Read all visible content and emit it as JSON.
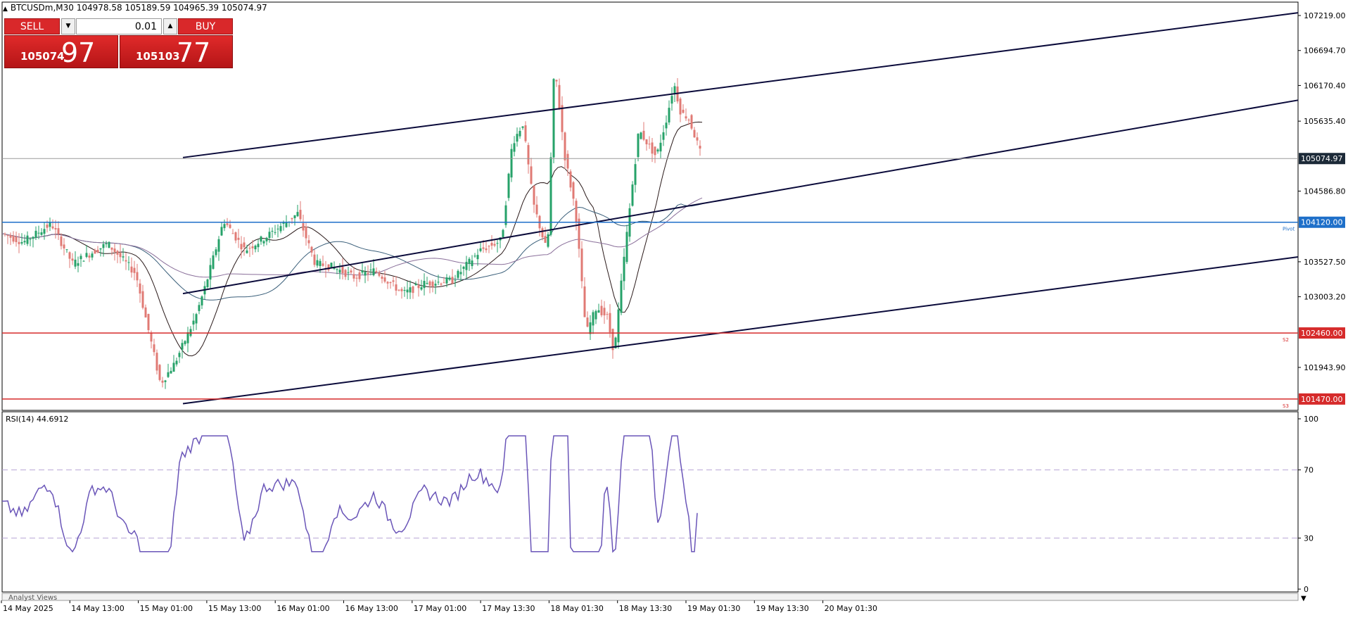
{
  "header": {
    "symbol_line": "BTCUSDm,M30  104978.58 105189.59 104965.39 105074.97"
  },
  "trade_panel": {
    "sell_label": "SELL",
    "buy_label": "BUY",
    "lot_value": "0.01",
    "sell_price_prefix": "105074",
    "sell_price_big": "97",
    "buy_price_prefix": "105103",
    "buy_price_big": "77"
  },
  "price_axis": {
    "ticks": [
      "107219.00",
      "106694.70",
      "106170.40",
      "105635.40",
      "104586.80",
      "103527.50",
      "103003.20",
      "101943.90"
    ],
    "current_price_label": "105074.97"
  },
  "levels": {
    "pivot": {
      "value": "104120.00",
      "tag": "Pivot",
      "color": "#1e6fc9"
    },
    "s2": {
      "value": "102460.00",
      "tag": "S2",
      "color": "#d62b2b"
    },
    "s3": {
      "value": "101470.00",
      "tag": "S3",
      "color": "#d62b2b"
    }
  },
  "rsi": {
    "label": "RSI(14) 44.6912",
    "levels": [
      "100",
      "70",
      "30",
      "0"
    ],
    "color": "#6a55b8"
  },
  "time_axis": {
    "labels": [
      "14 May 2025",
      "14 May 13:00",
      "15 May 01:00",
      "15 May 13:00",
      "16 May 01:00",
      "16 May 13:00",
      "17 May 01:00",
      "17 May 13:30",
      "18 May 01:30",
      "18 May 13:30",
      "19 May 01:30",
      "19 May 13:30",
      "20 May 01:30"
    ]
  },
  "bottom_tab": "Analyst Views",
  "colors": {
    "bull": "#26a269",
    "bear": "#e07a74",
    "channel": "#0a0a3a",
    "sell_red": "#d9282a"
  },
  "chart_data": {
    "type": "candlestick",
    "timeframe": "M30",
    "close_path_points": [
      [
        0,
        103950
      ],
      [
        30,
        103820
      ],
      [
        70,
        104100
      ],
      [
        100,
        103500
      ],
      [
        150,
        103800
      ],
      [
        190,
        103350
      ],
      [
        225,
        101700
      ],
      [
        245,
        102000
      ],
      [
        275,
        102700
      ],
      [
        290,
        103200
      ],
      [
        315,
        104150
      ],
      [
        345,
        103700
      ],
      [
        375,
        103900
      ],
      [
        420,
        104250
      ],
      [
        445,
        103500
      ],
      [
        470,
        103450
      ],
      [
        500,
        103300
      ],
      [
        530,
        103400
      ],
      [
        570,
        103050
      ],
      [
        600,
        103200
      ],
      [
        640,
        103250
      ],
      [
        680,
        103700
      ],
      [
        710,
        103850
      ],
      [
        725,
        105300
      ],
      [
        740,
        105600
      ],
      [
        755,
        104400
      ],
      [
        775,
        103650
      ],
      [
        785,
        106500
      ],
      [
        800,
        105100
      ],
      [
        815,
        104300
      ],
      [
        830,
        102450
      ],
      [
        845,
        102850
      ],
      [
        860,
        102700
      ],
      [
        870,
        102150
      ],
      [
        880,
        103200
      ],
      [
        895,
        104600
      ],
      [
        905,
        105500
      ],
      [
        930,
        105100
      ],
      [
        945,
        105700
      ],
      [
        955,
        106200
      ],
      [
        965,
        105750
      ],
      [
        975,
        105700
      ],
      [
        985,
        105400
      ],
      [
        995,
        105075
      ]
    ],
    "channel_lines": [
      {
        "name": "upper",
        "from": [
          0,
          105090
        ],
        "to": [
          1290,
          107260
        ]
      },
      {
        "name": "middle",
        "from": [
          0,
          103050
        ],
        "to": [
          1290,
          105950
        ]
      },
      {
        "name": "lower",
        "from": [
          0,
          101400
        ],
        "to": [
          1290,
          103600
        ]
      }
    ],
    "rsi_period": 14,
    "rsi_last": 44.6912,
    "rsi_ylim": [
      0,
      100
    ],
    "ylim": [
      101300,
      107420
    ]
  }
}
